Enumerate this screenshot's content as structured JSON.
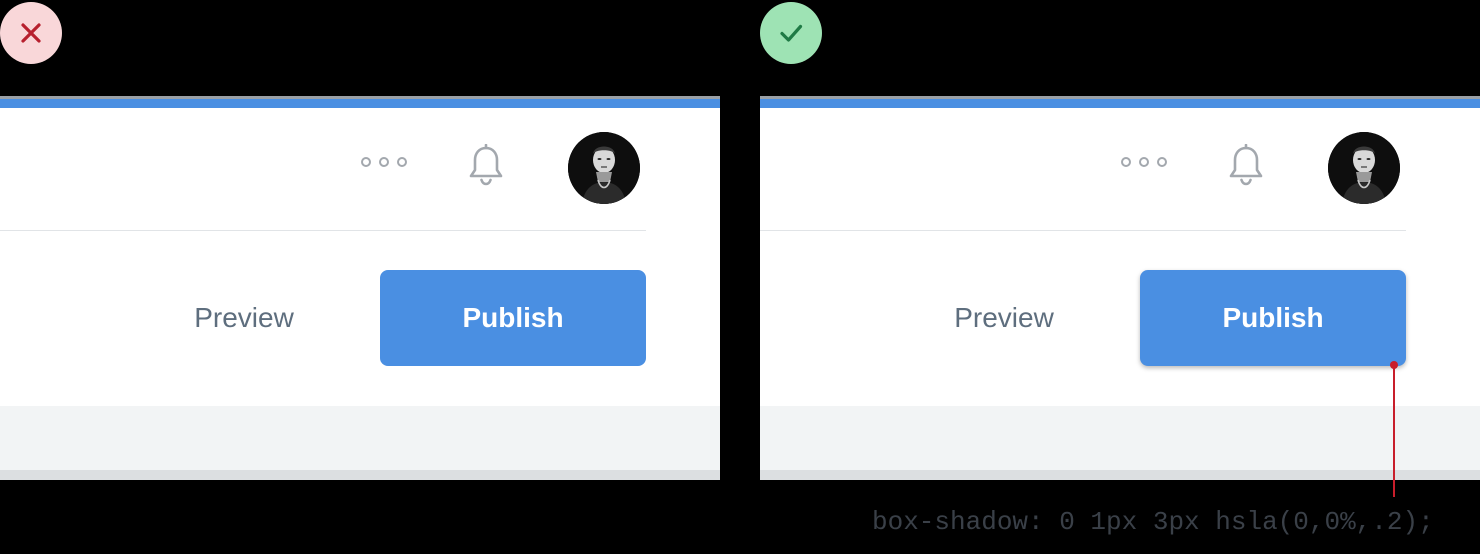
{
  "colors": {
    "accent": "#4a8fe2",
    "bad_badge_bg": "#f9d7d9",
    "bad_badge_icon": "#b7202e",
    "good_badge_bg": "#9ee3b4",
    "good_badge_icon": "#1f7a45",
    "icon_gray": "#a3a8ae",
    "preview_text": "#5e6e7e",
    "callout": "#c81e2b"
  },
  "bad_example": {
    "badge_icon": "close-icon",
    "toolbar": {
      "more_icon": "more-horizontal-icon",
      "bell_icon": "bell-icon",
      "avatar": "user-avatar"
    },
    "actions": {
      "preview_label": "Preview",
      "publish_label": "Publish"
    }
  },
  "good_example": {
    "badge_icon": "check-icon",
    "toolbar": {
      "more_icon": "more-horizontal-icon",
      "bell_icon": "bell-icon",
      "avatar": "user-avatar"
    },
    "actions": {
      "preview_label": "Preview",
      "publish_label": "Publish"
    }
  },
  "annotation": {
    "code": "box-shadow: 0 1px 3px hsla(0,0%,.2);"
  }
}
